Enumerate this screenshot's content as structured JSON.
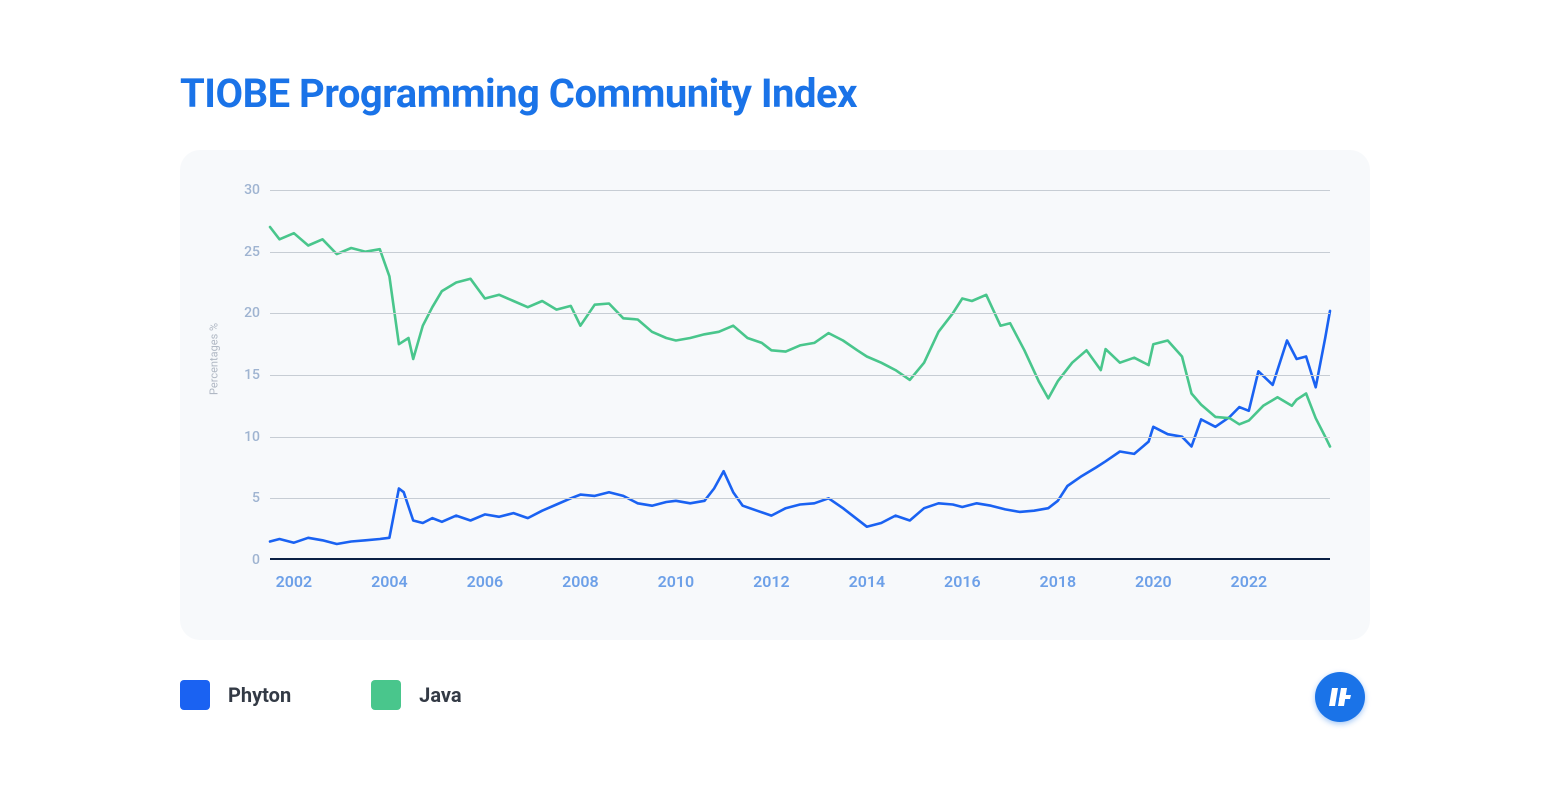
{
  "title": "TIOBE Programming Community Index",
  "legend": [
    {
      "label": "Phyton",
      "color": "#1a62f2"
    },
    {
      "label": "Java",
      "color": "#49c68c"
    }
  ],
  "logo_text": "IT",
  "chart_data": {
    "type": "line",
    "title": "TIOBE Programming Community Index",
    "xlabel": "",
    "ylabel": "Percentages %",
    "ylim": [
      0,
      30
    ],
    "yticks": [
      0,
      5,
      10,
      15,
      20,
      25,
      30
    ],
    "xticks": [
      2002,
      2004,
      2006,
      2008,
      2010,
      2012,
      2014,
      2016,
      2018,
      2020,
      2022
    ],
    "x_range": [
      2001.5,
      2023.7
    ],
    "series": [
      {
        "name": "Phyton",
        "color": "#1a62f2",
        "x": [
          2001.5,
          2001.7,
          2002.0,
          2002.3,
          2002.6,
          2002.9,
          2003.2,
          2003.5,
          2003.8,
          2004.0,
          2004.2,
          2004.3,
          2004.5,
          2004.7,
          2004.9,
          2005.1,
          2005.4,
          2005.7,
          2006.0,
          2006.3,
          2006.6,
          2006.9,
          2007.2,
          2007.5,
          2007.8,
          2008.0,
          2008.3,
          2008.6,
          2008.9,
          2009.2,
          2009.5,
          2009.8,
          2010.0,
          2010.3,
          2010.6,
          2010.8,
          2011.0,
          2011.2,
          2011.4,
          2011.7,
          2012.0,
          2012.3,
          2012.6,
          2012.9,
          2013.2,
          2013.5,
          2013.8,
          2014.0,
          2014.3,
          2014.6,
          2014.9,
          2015.2,
          2015.5,
          2015.8,
          2016.0,
          2016.3,
          2016.6,
          2016.9,
          2017.2,
          2017.5,
          2017.8,
          2018.0,
          2018.2,
          2018.5,
          2018.8,
          2019.0,
          2019.3,
          2019.6,
          2019.9,
          2020.0,
          2020.3,
          2020.6,
          2020.8,
          2021.0,
          2021.3,
          2021.6,
          2021.8,
          2022.0,
          2022.2,
          2022.5,
          2022.8,
          2023.0,
          2023.2,
          2023.4,
          2023.6,
          2023.7
        ],
        "y": [
          1.5,
          1.7,
          1.4,
          1.8,
          1.6,
          1.3,
          1.5,
          1.6,
          1.7,
          1.8,
          5.8,
          5.5,
          3.2,
          3.0,
          3.4,
          3.1,
          3.6,
          3.2,
          3.7,
          3.5,
          3.8,
          3.4,
          4.0,
          4.5,
          5.0,
          5.3,
          5.2,
          5.5,
          5.2,
          4.6,
          4.4,
          4.7,
          4.8,
          4.6,
          4.8,
          5.8,
          7.2,
          5.5,
          4.4,
          4.0,
          3.6,
          4.2,
          4.5,
          4.6,
          5.0,
          4.2,
          3.3,
          2.7,
          3.0,
          3.6,
          3.2,
          4.2,
          4.6,
          4.5,
          4.3,
          4.6,
          4.4,
          4.1,
          3.9,
          4.0,
          4.2,
          4.8,
          6.0,
          6.8,
          7.5,
          8.0,
          8.8,
          8.6,
          9.6,
          10.8,
          10.2,
          10.0,
          9.2,
          11.4,
          10.8,
          11.6,
          12.4,
          12.1,
          15.3,
          14.2,
          17.8,
          16.3,
          16.5,
          14.0,
          18.0,
          20.2
        ]
      },
      {
        "name": "Java",
        "color": "#49c68c",
        "x": [
          2001.5,
          2001.7,
          2002.0,
          2002.3,
          2002.6,
          2002.9,
          2003.2,
          2003.5,
          2003.8,
          2004.0,
          2004.2,
          2004.4,
          2004.5,
          2004.7,
          2004.9,
          2005.1,
          2005.4,
          2005.7,
          2006.0,
          2006.3,
          2006.6,
          2006.9,
          2007.2,
          2007.5,
          2007.8,
          2008.0,
          2008.3,
          2008.6,
          2008.9,
          2009.2,
          2009.5,
          2009.8,
          2010.0,
          2010.3,
          2010.6,
          2010.9,
          2011.2,
          2011.5,
          2011.8,
          2012.0,
          2012.3,
          2012.6,
          2012.9,
          2013.2,
          2013.5,
          2013.8,
          2014.0,
          2014.3,
          2014.6,
          2014.9,
          2015.2,
          2015.5,
          2015.8,
          2016.0,
          2016.2,
          2016.5,
          2016.8,
          2017.0,
          2017.3,
          2017.6,
          2017.8,
          2018.0,
          2018.3,
          2018.6,
          2018.9,
          2019.0,
          2019.3,
          2019.6,
          2019.9,
          2020.0,
          2020.3,
          2020.6,
          2020.8,
          2021.0,
          2021.3,
          2021.6,
          2021.8,
          2022.0,
          2022.3,
          2022.6,
          2022.9,
          2023.0,
          2023.2,
          2023.4,
          2023.6,
          2023.7
        ],
        "y": [
          27.0,
          26.0,
          26.5,
          25.5,
          26.0,
          24.8,
          25.3,
          25.0,
          25.2,
          23.0,
          17.5,
          18.0,
          16.3,
          19.0,
          20.5,
          21.8,
          22.5,
          22.8,
          21.2,
          21.5,
          21.0,
          20.5,
          21.0,
          20.3,
          20.6,
          19.0,
          20.7,
          20.8,
          19.6,
          19.5,
          18.5,
          18.0,
          17.8,
          18.0,
          18.3,
          18.5,
          19.0,
          18.0,
          17.6,
          17.0,
          16.9,
          17.4,
          17.6,
          18.4,
          17.8,
          17.0,
          16.5,
          16.0,
          15.4,
          14.6,
          16.0,
          18.5,
          20.0,
          21.2,
          21.0,
          21.5,
          19.0,
          19.2,
          17.0,
          14.5,
          13.1,
          14.5,
          16.0,
          17.0,
          15.4,
          17.1,
          16.0,
          16.4,
          15.8,
          17.5,
          17.8,
          16.5,
          13.5,
          12.6,
          11.6,
          11.5,
          11.0,
          11.3,
          12.5,
          13.2,
          12.5,
          13.0,
          13.5,
          11.5,
          10.0,
          9.2
        ]
      }
    ]
  }
}
